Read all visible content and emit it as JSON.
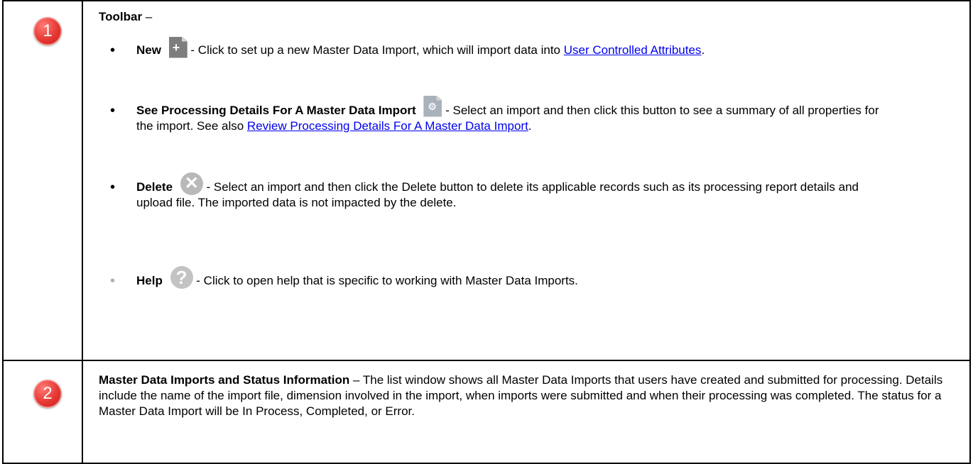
{
  "rows": [
    {
      "number": "1",
      "heading": "Toolbar",
      "heading_suffix": " –",
      "items": [
        {
          "label": "New",
          "icon": "new-document-icon",
          "text": " - Click to set up a new Master Data Import, which will import data into ",
          "link": "User Controlled Attributes",
          "after": "."
        },
        {
          "label": "See Processing Details For A Master Data Import",
          "icon": "processing-details-icon",
          "text": " - Select an import and then click this button to see a summary of all properties for the import. See also ",
          "link": "Review Processing Details For A Master Data Import",
          "after": "."
        },
        {
          "label": "Delete",
          "icon": "delete-icon",
          "text": " - Select an import and then click the Delete button to delete its applicable records such as its processing report details and upload file. The imported data is not impacted by the delete."
        },
        {
          "label": "Help",
          "icon": "help-icon",
          "text": " - Click to open help that is specific to working with Master Data Imports."
        }
      ]
    },
    {
      "number": "2",
      "heading": "Master Data Imports and Status Information",
      "text": " – The list window shows all Master Data Imports that users have created and submitted for processing. Details include the name of the import file, dimension involved in the import, when imports were submitted and when their processing was completed. The status for a Master Data Import will be In Process, Completed, or Error."
    }
  ],
  "colors": {
    "badge": "#e53630",
    "link": "#0000ee",
    "icon_grey": "#7d7d7d"
  }
}
